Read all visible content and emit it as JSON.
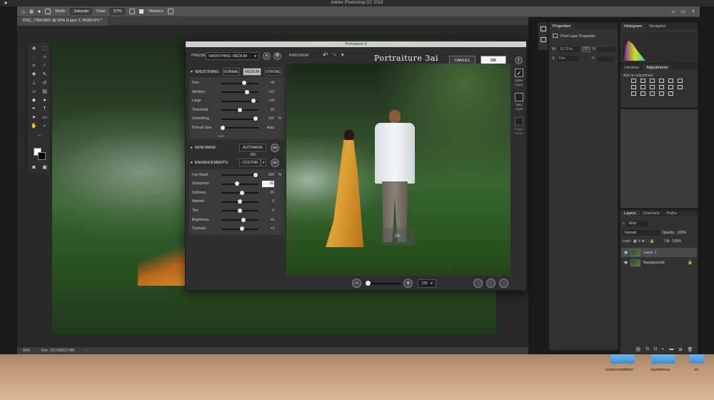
{
  "window": {
    "title": "Adobe Photoshop CC 2019"
  },
  "options_bar": {
    "mode_label": "Mode:",
    "mode_value": "Saturate",
    "flow_label": "Flow:",
    "flow_value": "57%",
    "vibrance_label": "Vibrance"
  },
  "document": {
    "tab_label": "DSC_7084.NEF @ 50% (Layer 1, RGB/16*) *",
    "status_zoom": "50%",
    "status_doc": "Doc: 115.0M/227.0M"
  },
  "properties": {
    "title": "Properties",
    "subtitle": "Pixel Layer Properties",
    "w_label": "W:",
    "w_value": "12.73 in",
    "x_label": "X:",
    "x_value": "0 in",
    "h_label": "H:",
    "y_label": "Y:",
    "link": "GO"
  },
  "histogram": {
    "tabs": [
      "Histogram",
      "Navigator"
    ]
  },
  "adjustments": {
    "tabs": [
      "Libraries",
      "Adjustments"
    ],
    "hint": "Add an adjustment"
  },
  "layers": {
    "tabs": [
      "Layers",
      "Channels",
      "Paths"
    ],
    "kind": "Kind",
    "blend": "Normal",
    "opacity_label": "Opacity:",
    "opacity_value": "100%",
    "lock_label": "Lock:",
    "fill_label": "Fill:",
    "fill_value": "100%",
    "items": [
      {
        "name": "Layer 1"
      },
      {
        "name": "Background"
      }
    ]
  },
  "desktop": {
    "icons": [
      "Gutierrezfallfam",
      "skylarkmas",
      "sn"
    ]
  },
  "plugin": {
    "title": "Portraiture 3",
    "preset_label": "PRESET",
    "preset_value": "SMOOTHING: MEDIUM",
    "preview_label": "PREVIEW",
    "brand": "Portraiture 3ai",
    "cancel_label": "CANCEL",
    "ok_label": "OK",
    "smoothing": {
      "header": "SMOOTHING",
      "modes": [
        "NORMAL",
        "MEDIUM",
        "STRONG"
      ],
      "selected_mode": "MEDIUM",
      "sliders": [
        {
          "label": "Fine",
          "value": "+8",
          "unit": "",
          "pos": 0.62
        },
        {
          "label": "Medium",
          "value": "+12",
          "unit": "",
          "pos": 0.7
        },
        {
          "label": "Large",
          "value": "+18",
          "unit": "",
          "pos": 0.86
        },
        {
          "label": "Threshold",
          "value": "20",
          "unit": "",
          "pos": 0.5
        },
        {
          "label": "Smoothing",
          "value": "100",
          "unit": "%",
          "pos": 0.93
        },
        {
          "label": "Portrait Size",
          "value": "Auto",
          "unit": "",
          "pos": 0.04
        }
      ],
      "auto_note": "Auto"
    },
    "skin_mask": {
      "header": "SKIN MASK",
      "automask": "AUTOMASK ON",
      "toggle": "On"
    },
    "enhancements": {
      "header": "ENHANCEMENTS",
      "preset": "CUSTOM",
      "toggle": "On",
      "sliders": [
        {
          "label": "Use Mask",
          "value": "100",
          "unit": "%",
          "pos": 0.93
        },
        {
          "label": "Sharpness",
          "value": "16",
          "unit": "",
          "pos": 0.42,
          "editing": true
        },
        {
          "label": "Softness",
          "value": "23",
          "unit": "",
          "pos": 0.55
        },
        {
          "label": "Warmth",
          "value": "0",
          "unit": "",
          "pos": 0.5
        },
        {
          "label": "Tint",
          "value": "0",
          "unit": "",
          "pos": 0.5
        },
        {
          "label": "Brightness",
          "value": "+9",
          "unit": "",
          "pos": 0.6
        },
        {
          "label": "Contrast",
          "value": "+3",
          "unit": "",
          "pos": 0.55
        }
      ]
    },
    "preview_overlay": "0%",
    "zoom_value": "195",
    "side_options": [
      "Same Layer",
      "New Layer",
      "Output Mask"
    ]
  }
}
